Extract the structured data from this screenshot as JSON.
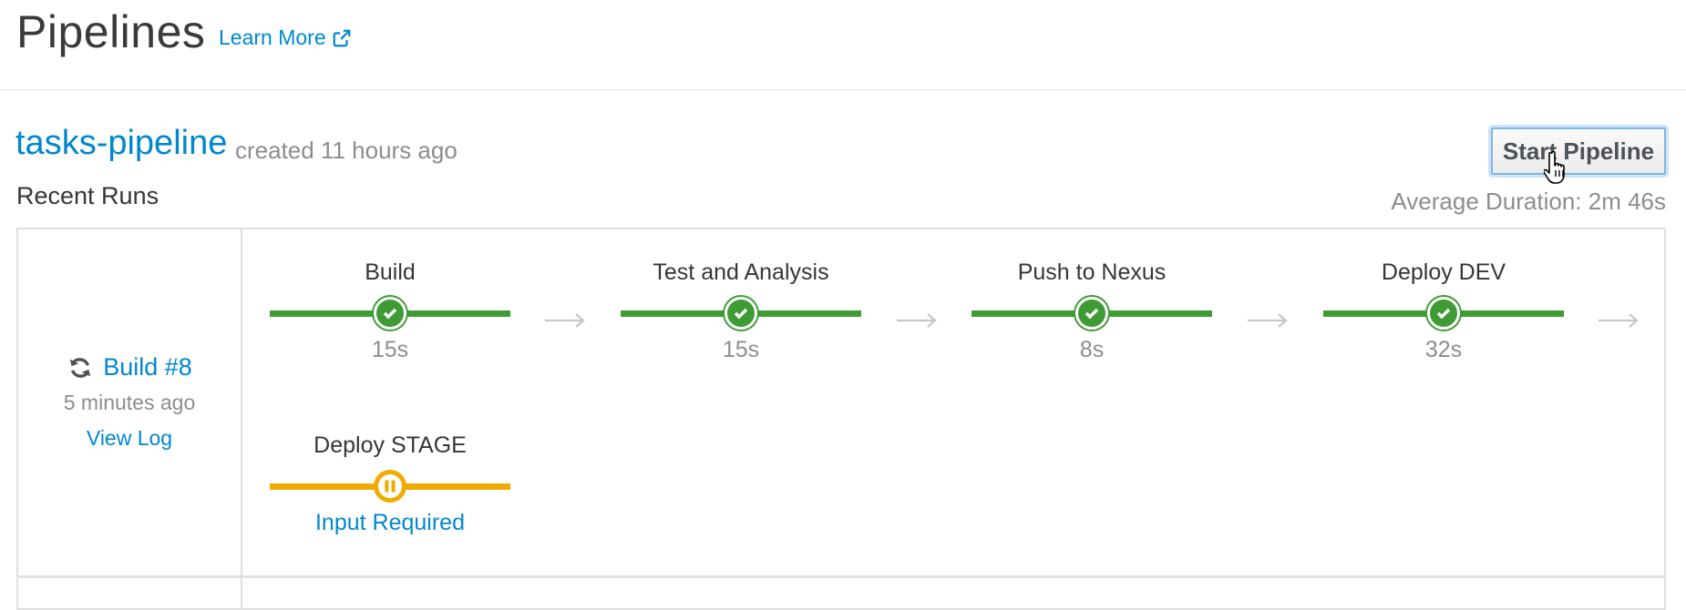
{
  "header": {
    "title": "Pipelines",
    "learn_more": "Learn More",
    "learn_more_icon": "external-link-icon"
  },
  "pipeline": {
    "name": "tasks-pipeline",
    "created": "created 11 hours ago",
    "start_button": "Start Pipeline",
    "recent_runs_label": "Recent Runs",
    "average_duration": "Average Duration: 2m 46s"
  },
  "run": {
    "status_icon": "sync-icon",
    "build_label": "Build #8",
    "time_ago": "5 minutes ago",
    "view_log": "View Log",
    "stages": [
      {
        "name": "Build",
        "status": "success",
        "duration": "15s"
      },
      {
        "name": "Test and Analysis",
        "status": "success",
        "duration": "15s"
      },
      {
        "name": "Push to Nexus",
        "status": "success",
        "duration": "8s"
      },
      {
        "name": "Deploy DEV",
        "status": "success",
        "duration": "32s"
      },
      {
        "name": "Deploy STAGE",
        "status": "paused",
        "action": "Input Required"
      }
    ]
  },
  "colors": {
    "link": "#0088ce",
    "success": "#3f9c35",
    "paused": "#f0ab00"
  }
}
